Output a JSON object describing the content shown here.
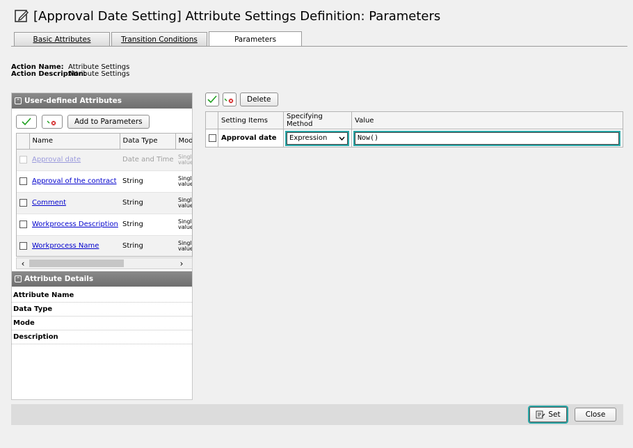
{
  "title": "[Approval Date Setting] Attribute Settings Definition: Parameters",
  "tabs": [
    {
      "label": "Basic Attributes",
      "active": false
    },
    {
      "label": "Transition Conditions",
      "active": false
    },
    {
      "label": "Parameters",
      "active": true
    }
  ],
  "action": {
    "name_label": "Action Name:",
    "name_value": "Attribute Settings",
    "desc_label": "Action Description:",
    "desc_value": "Attribute Settings"
  },
  "user_attributes": {
    "header": "User-defined Attributes",
    "add_button": "Add to Parameters",
    "columns": [
      "Name",
      "Data Type",
      "Mode"
    ],
    "rows": [
      {
        "name": "Approval date",
        "type": "Date and Time",
        "mode": "Single value",
        "disabled": true
      },
      {
        "name": "Approval of the contract",
        "type": "String",
        "mode": "Single value",
        "disabled": false
      },
      {
        "name": "Comment",
        "type": "String",
        "mode": "Single value",
        "disabled": false
      },
      {
        "name": "Workprocess Description",
        "type": "String",
        "mode": "Single value",
        "disabled": false
      },
      {
        "name": "Workprocess Name",
        "type": "String",
        "mode": "Single value",
        "disabled": false
      }
    ]
  },
  "attribute_details": {
    "header": "Attribute Details",
    "fields": [
      "Attribute Name",
      "Data Type",
      "Mode",
      "Description"
    ]
  },
  "parameters": {
    "delete_button": "Delete",
    "columns": [
      "Setting Items",
      "Specifying Method",
      "Value"
    ],
    "rows": [
      {
        "setting": "Approval date",
        "method": "Expression",
        "value": "Now()"
      }
    ]
  },
  "footer": {
    "set_button": "Set",
    "close_button": "Close"
  },
  "colors": {
    "section_header": "#7a7a7a",
    "focus_outline": "#2aa8a8",
    "link": "#0000cc",
    "check_green": "#1fa01f",
    "remove_red": "#d21f1f"
  }
}
